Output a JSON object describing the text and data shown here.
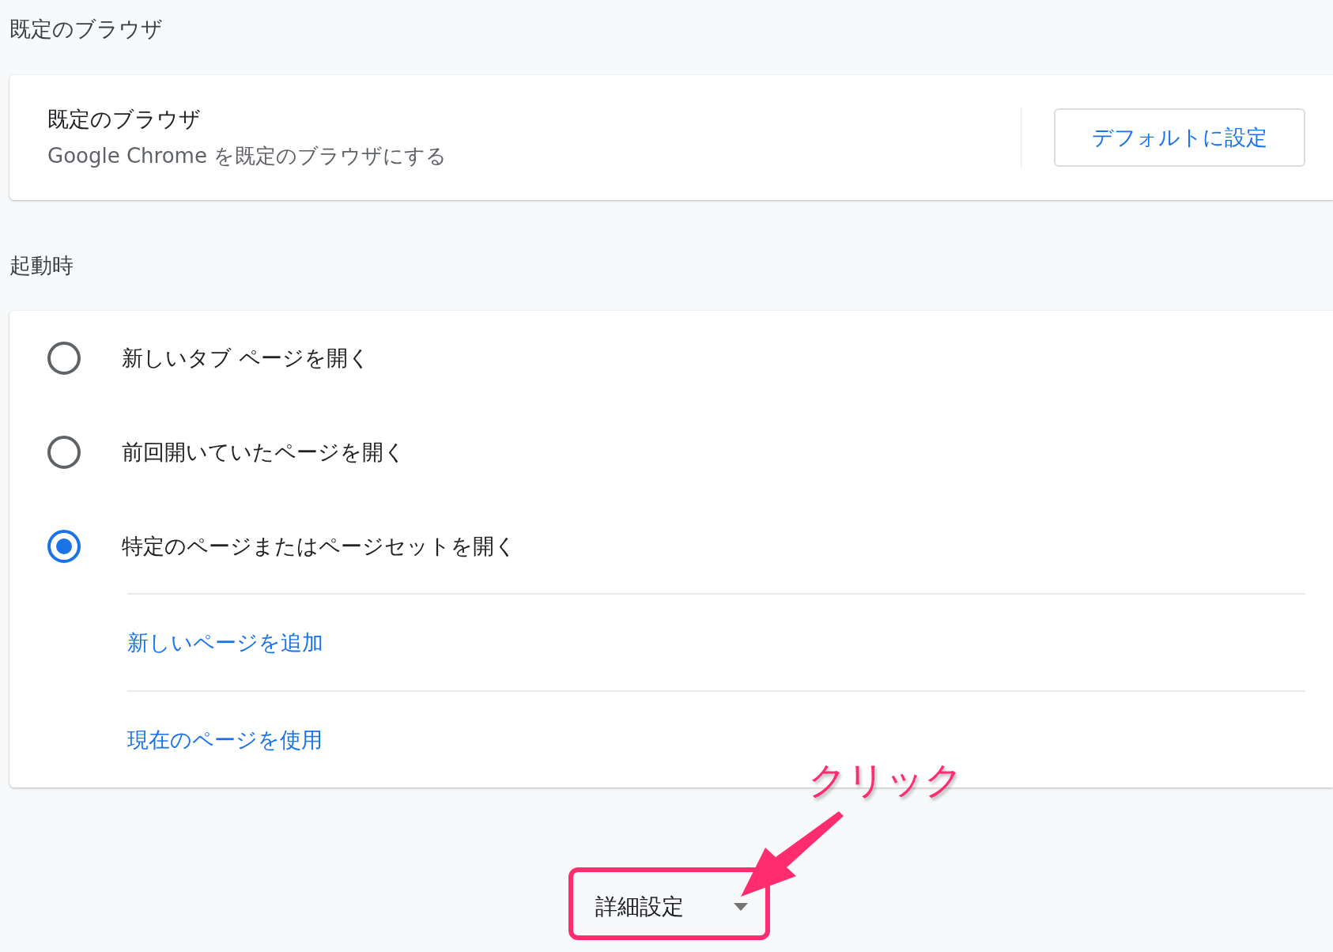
{
  "default_browser": {
    "heading": "既定のブラウザ",
    "title": "既定のブラウザ",
    "description": "Google Chrome を既定のブラウザにする",
    "button": "デフォルトに設定"
  },
  "startup": {
    "heading": "起動時",
    "options": [
      {
        "label": "新しいタブ ページを開く",
        "selected": false
      },
      {
        "label": "前回開いていたページを開く",
        "selected": false
      },
      {
        "label": "特定のページまたはページセットを開く",
        "selected": true
      }
    ],
    "links": [
      "新しいページを追加",
      "現在のページを使用"
    ]
  },
  "advanced": {
    "label": "詳細設定",
    "expanded": false
  },
  "annotation": {
    "label": "クリック"
  }
}
